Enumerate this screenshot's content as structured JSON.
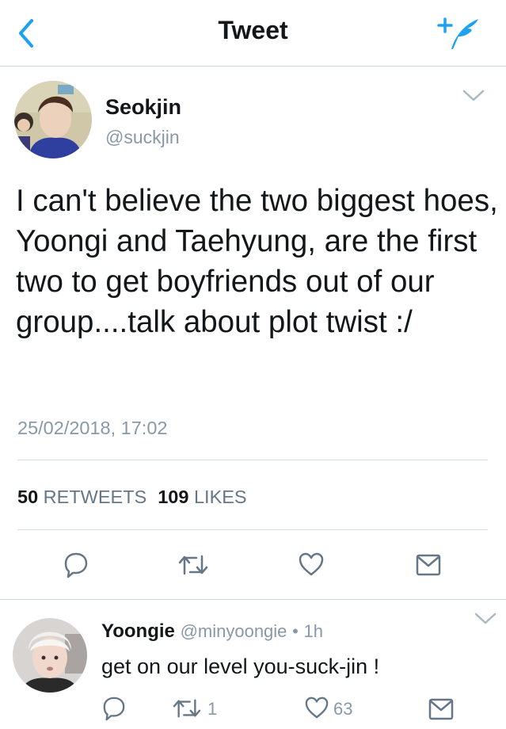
{
  "header": {
    "title": "Tweet",
    "back_icon": "chevron-left-icon",
    "compose_icon": "compose-tweet-icon",
    "accent_color": "#1da1f2"
  },
  "tweet": {
    "name": "Seokjin",
    "handle": "@suckjin",
    "text": "I can't believe the two biggest hoes, Yoongi and Taehyung, are the first two to get boyfriends out of our group....talk about plot twist :/",
    "timestamp": "25/02/2018, 17:02",
    "retweets_count": "50",
    "retweets_label": "RETWEETS",
    "likes_count": "109",
    "likes_label": "LIKES",
    "actions": [
      "reply-icon",
      "retweet-icon",
      "like-icon",
      "share-icon"
    ]
  },
  "reply": {
    "name": "Yoongie",
    "handle": "@minyoongie",
    "separator": "•",
    "time": "1h",
    "text": "get on our level you-suck-jin !",
    "retweet_count": "1",
    "like_count": "63"
  }
}
